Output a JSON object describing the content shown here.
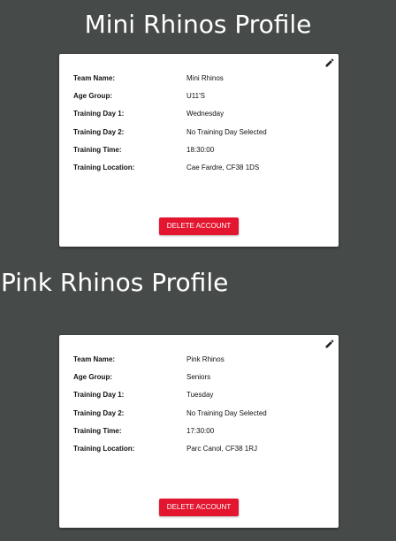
{
  "profiles": [
    {
      "title": "Mini Rhinos Profile",
      "fields": [
        {
          "label": "Team Name:",
          "value": "Mini Rhinos"
        },
        {
          "label": "Age Group:",
          "value": "U11'S"
        },
        {
          "label": "Training Day 1:",
          "value": "Wednesday"
        },
        {
          "label": "Training Day 2:",
          "value": "No Training Day Selected"
        },
        {
          "label": "Training Time:",
          "value": "18:30:00"
        },
        {
          "label": "Training Location:",
          "value": "Cae Fardre, CF38 1DS"
        }
      ],
      "delete_label": "DELETE ACCOUNT",
      "edit_icon": "pencil-icon"
    },
    {
      "title": "Pink Rhinos Profile",
      "fields": [
        {
          "label": "Team Name:",
          "value": "Pink Rhinos"
        },
        {
          "label": "Age Group:",
          "value": "Seniors"
        },
        {
          "label": "Training Day 1:",
          "value": "Tuesday"
        },
        {
          "label": "Training Day 2:",
          "value": "No Training Day Selected"
        },
        {
          "label": "Training Time:",
          "value": "17:30:00"
        },
        {
          "label": "Training Location:",
          "value": "Parc Canol, CF38 1RJ"
        }
      ],
      "delete_label": "DELETE ACCOUNT",
      "edit_icon": "pencil-icon"
    }
  ],
  "colors": {
    "background": "#464a49",
    "card": "#ffffff",
    "delete_button": "#e3152f",
    "title_text": "#ffffff"
  }
}
